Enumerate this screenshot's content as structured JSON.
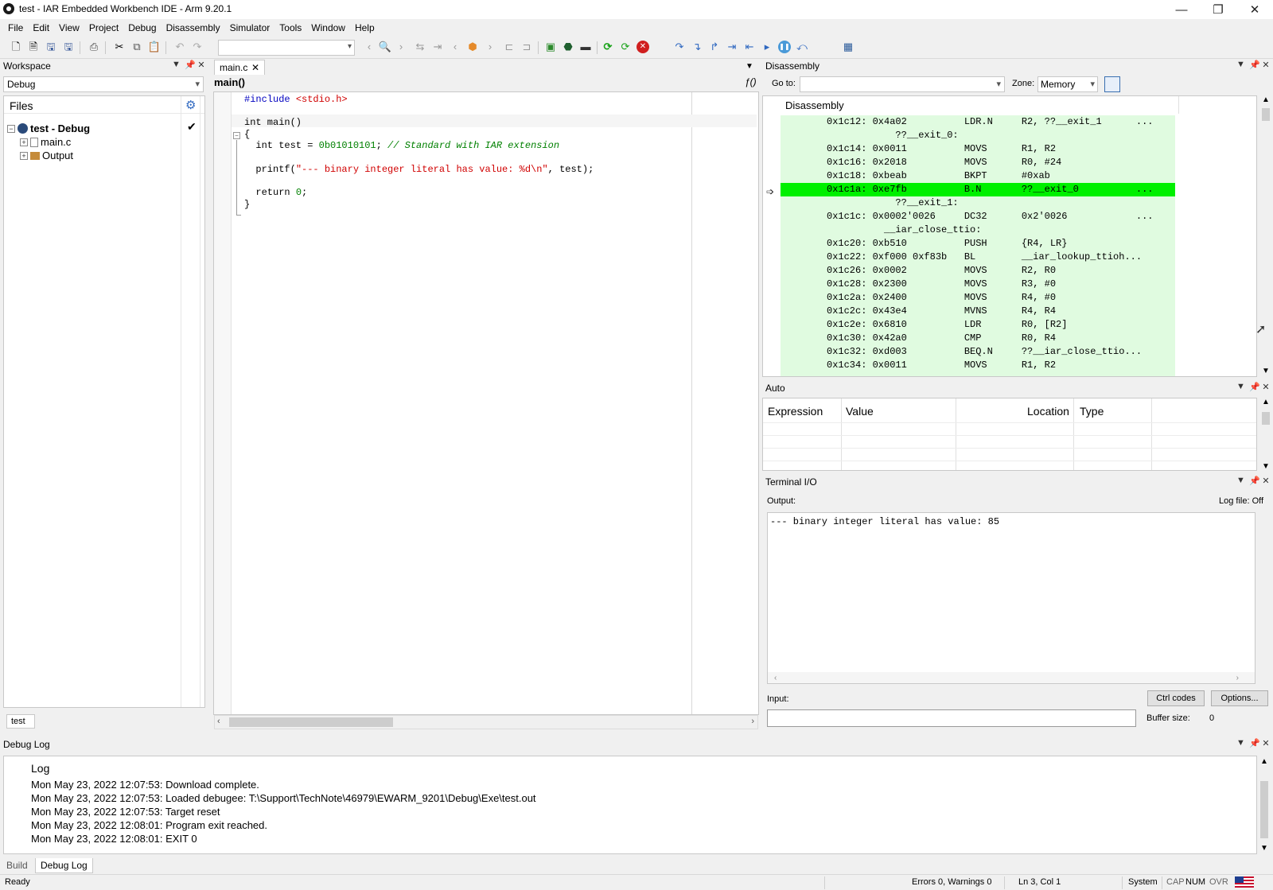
{
  "window": {
    "title": "test - IAR Embedded Workbench IDE - Arm 9.20.1"
  },
  "menu": [
    "File",
    "Edit",
    "View",
    "Project",
    "Debug",
    "Disassembly",
    "Simulator",
    "Tools",
    "Window",
    "Help"
  ],
  "workspace": {
    "title": "Workspace",
    "config": "Debug",
    "files_header": "Files",
    "project": "test - Debug",
    "items": [
      "main.c",
      "Output"
    ],
    "tab": "test"
  },
  "editor": {
    "tab": "main.c",
    "function": "main()",
    "code": {
      "l1_pp": "#include",
      "l1_hdr": "<stdio.h>",
      "l2": "int main()",
      "l3": "{",
      "l4_a": "  int test = ",
      "l4_num": "0b01010101",
      "l4_b": "; ",
      "l4_com": "// Standard with IAR extension",
      "l5_a": "  printf(",
      "l5_str": "\"--- binary integer literal has value: %d\\n\"",
      "l5_b": ", test);",
      "l6_a": "  return ",
      "l6_num": "0",
      "l6_b": ";",
      "l7": "}"
    }
  },
  "disassembly": {
    "title": "Disassembly",
    "goto_label": "Go to:",
    "zone_label": "Zone:",
    "zone_value": "Memory",
    "listing_header": "Disassembly",
    "rows": [
      "0x1c12: 0x4a02          LDR.N     R2, ??__exit_1      ...",
      "            ??__exit_0:",
      "0x1c14: 0x0011          MOVS      R1, R2",
      "0x1c16: 0x2018          MOVS      R0, #24",
      "0x1c18: 0xbeab          BKPT      #0xab",
      "0x1c1a: 0xe7fb          B.N       ??__exit_0          ...",
      "            ??__exit_1:",
      "0x1c1c: 0x0002'0026     DC32      0x2'0026            ...",
      "          __iar_close_ttio:",
      "0x1c20: 0xb510          PUSH      {R4, LR}",
      "0x1c22: 0xf000 0xf83b   BL        __iar_lookup_ttioh...",
      "0x1c26: 0x0002          MOVS      R2, R0",
      "0x1c28: 0x2300          MOVS      R3, #0",
      "0x1c2a: 0x2400          MOVS      R4, #0",
      "0x1c2c: 0x43e4          MVNS      R4, R4",
      "0x1c2e: 0x6810          LDR       R0, [R2]",
      "0x1c30: 0x42a0          CMP       R0, R4",
      "0x1c32: 0xd003          BEQ.N     ??__iar_close_ttio...",
      "0x1c34: 0x0011          MOVS      R1, R2"
    ],
    "current_row": 5,
    "colors": {
      "current": "#00f000",
      "background": "#e0fbe0"
    }
  },
  "auto": {
    "title": "Auto",
    "columns": [
      "Expression",
      "Value",
      "Location",
      "Type"
    ]
  },
  "terminal": {
    "title": "Terminal I/O",
    "output_label": "Output:",
    "logfile": "Log file: Off",
    "output": "--- binary integer literal has value: 85",
    "input_label": "Input:",
    "ctrl_codes": "Ctrl codes",
    "options": "Options...",
    "buffer_label": "Buffer size:",
    "buffer_value": "0"
  },
  "debuglog": {
    "title": "Debug Log",
    "header": "Log",
    "lines": [
      "Mon May 23, 2022 12:07:53: Download complete.",
      "Mon May 23, 2022 12:07:53: Loaded debugee: T:\\Support\\TechNote\\46979\\EWARM_9201\\Debug\\Exe\\test.out",
      "Mon May 23, 2022 12:07:53: Target reset",
      "Mon May 23, 2022 12:08:01: Program exit reached.",
      "Mon May 23, 2022 12:08:01: EXIT 0"
    ]
  },
  "bottom_tabs": [
    "Build",
    "Debug Log"
  ],
  "status": {
    "ready": "Ready",
    "errors": "Errors 0, Warnings 0",
    "position": "Ln 3, Col 1",
    "system": "System",
    "cap": "CAP",
    "num": "NUM",
    "ovr": "OVR"
  }
}
